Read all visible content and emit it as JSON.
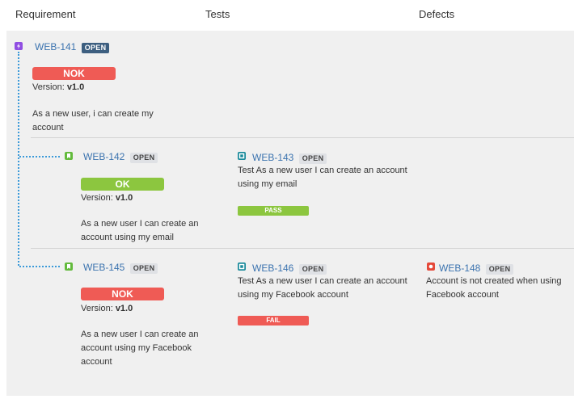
{
  "header": {
    "requirement": "Requirement",
    "tests": "Tests",
    "defects": "Defects"
  },
  "colors": {
    "link": "#3b73af",
    "ok": "#8cc63f",
    "nok": "#ef5b55",
    "epic_icon": "#904ee2",
    "story_icon": "#63ba3c",
    "test_icon": "#1a8a9b",
    "bug_icon": "#e5493a"
  },
  "epic": {
    "icon": "epic-icon",
    "key": "WEB-141",
    "status_badge": "OPEN",
    "result": "NOK",
    "version_label": "Version: ",
    "version": "v1.0",
    "summary": "As a new user, i can create my account"
  },
  "rows": [
    {
      "story": {
        "icon": "story-icon",
        "key": "WEB-142",
        "status_badge": "OPEN",
        "result": "OK",
        "version_label": "Version: ",
        "version": "v1.0",
        "summary": "As a new user I can create an account using my email"
      },
      "test": {
        "icon": "test-icon",
        "key": "WEB-143",
        "status_badge": "OPEN",
        "summary": "Test As a new user I can create an account using my email",
        "result": "PASS"
      }
    },
    {
      "story": {
        "icon": "story-icon",
        "key": "WEB-145",
        "status_badge": "OPEN",
        "result": "NOK",
        "version_label": "Version: ",
        "version": "v1.0",
        "summary": "As a new user I can create an account using my Facebook account"
      },
      "test": {
        "icon": "test-icon",
        "key": "WEB-146",
        "status_badge": "OPEN",
        "summary": "Test As a new user I can create an account using my Facebook account",
        "result": "FAIL"
      },
      "defect": {
        "icon": "bug-icon",
        "key": "WEB-148",
        "status_badge": "OPEN",
        "summary": "Account is not created when using Facebook account"
      }
    }
  ]
}
